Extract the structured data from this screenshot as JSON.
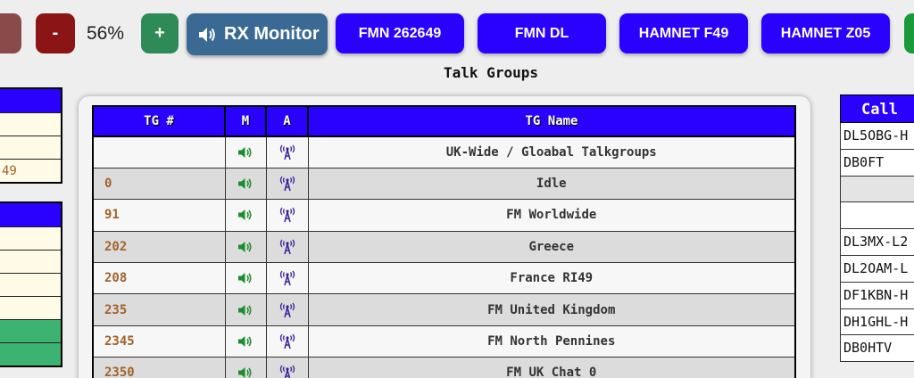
{
  "toolbar": {
    "minus_label": "-",
    "volume": "56%",
    "plus_label": "+",
    "rx_monitor_label": "RX Monitor",
    "buttons": [
      "FMN 262649",
      "FMN DL",
      "HAMNET F49",
      "HAMNET Z05"
    ],
    "colors": {
      "blue": "#2a00ff",
      "minus": "#8b1414",
      "plus": "#2e8b57",
      "rx": "#3a6a94"
    }
  },
  "talk_groups": {
    "title": "Talk Groups",
    "headers": {
      "tg": "TG #",
      "m": "M",
      "a": "A",
      "name": "TG Name"
    },
    "rows": [
      {
        "tg": "",
        "name": "UK-Wide / Gloabal Talkgroups"
      },
      {
        "tg": "0",
        "name": "Idle"
      },
      {
        "tg": "91",
        "name": "FM Worldwide"
      },
      {
        "tg": "202",
        "name": "Greece"
      },
      {
        "tg": "208",
        "name": "France RI49"
      },
      {
        "tg": "235",
        "name": "FM United Kingdom"
      },
      {
        "tg": "2345",
        "name": "FM North Pennines"
      },
      {
        "tg": "2350",
        "name": "FM UK Chat 0"
      }
    ],
    "icons": {
      "m": "speaker-icon",
      "a": "antenna-icon"
    }
  },
  "left_panel": {
    "cell_text": "49"
  },
  "call_list": {
    "header": "Call",
    "rows": [
      "DL5OBG-H",
      "DB0FT",
      "",
      "",
      "DL3MX-L2",
      "DL2OAM-L",
      "DF1KBN-H",
      "DH1GHL-H",
      "DB0HTV"
    ]
  }
}
